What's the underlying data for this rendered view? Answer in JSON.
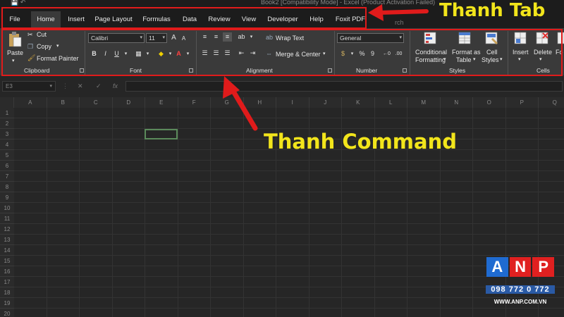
{
  "window": {
    "title": "Book2  [Compatibility Mode]  -  Excel (Product Activation Failed)",
    "qat_icons": [
      "save-icon",
      "undo-icon"
    ]
  },
  "tabs": [
    {
      "label": "File",
      "active": false
    },
    {
      "label": "Home",
      "active": true
    },
    {
      "label": "Insert",
      "active": false
    },
    {
      "label": "Page Layout",
      "active": false
    },
    {
      "label": "Formulas",
      "active": false
    },
    {
      "label": "Data",
      "active": false
    },
    {
      "label": "Review",
      "active": false
    },
    {
      "label": "View",
      "active": false
    },
    {
      "label": "Developer",
      "active": false
    },
    {
      "label": "Help",
      "active": false
    },
    {
      "label": "Foxit PDF",
      "active": false
    }
  ],
  "tab_search_partial": "rch",
  "ribbon": {
    "clipboard": {
      "paste": "Paste",
      "cut": "Cut",
      "copy": "Copy",
      "format_painter": "Format Painter",
      "label": "Clipboard"
    },
    "font": {
      "name": "Calibri",
      "size": "11",
      "grow": "A",
      "shrink": "A",
      "bold": "B",
      "italic": "I",
      "underline": "U",
      "font_color": "A",
      "label": "Font"
    },
    "alignment": {
      "wrap_text": "Wrap Text",
      "merge_center": "Merge & Center",
      "label": "Alignment"
    },
    "number": {
      "format": "General",
      "percent": "%",
      "comma": "9",
      "label": "Number"
    },
    "styles": {
      "conditional_formatting_1": "Conditional",
      "conditional_formatting_2": "Formatting",
      "format_as_table_1": "Format as",
      "format_as_table_2": "Table",
      "cell_styles_1": "Cell",
      "cell_styles_2": "Styles",
      "label": "Styles"
    },
    "cells": {
      "insert": "Insert",
      "delete": "Delete",
      "format_partial": "Fo",
      "label": "Cells"
    }
  },
  "formula_bar": {
    "name_box": "E3",
    "cancel": "✕",
    "enter": "✓",
    "fx": "fx",
    "value": ""
  },
  "grid": {
    "columns": [
      "A",
      "B",
      "C",
      "D",
      "E",
      "F",
      "G",
      "H",
      "I",
      "J",
      "K",
      "L",
      "M",
      "N",
      "O",
      "P",
      "Q"
    ],
    "rows": [
      "1",
      "2",
      "3",
      "4",
      "5",
      "6",
      "7",
      "8",
      "9",
      "10",
      "11",
      "12",
      "13",
      "14",
      "15",
      "16",
      "17",
      "18",
      "19",
      "20"
    ],
    "selected_cell": "E3"
  },
  "annotations": {
    "tab_label": "Thanh Tab",
    "command_label": "Thanh Command",
    "color": "#f2e51b",
    "box_color": "#e01b1b"
  },
  "watermark": {
    "letters": [
      "A",
      "N",
      "P"
    ],
    "letter_colors": [
      "#1f6bd1",
      "#e02020",
      "#e02020"
    ],
    "phone": "098 772 0 772",
    "website": "WWW.ANP.COM.VN"
  }
}
